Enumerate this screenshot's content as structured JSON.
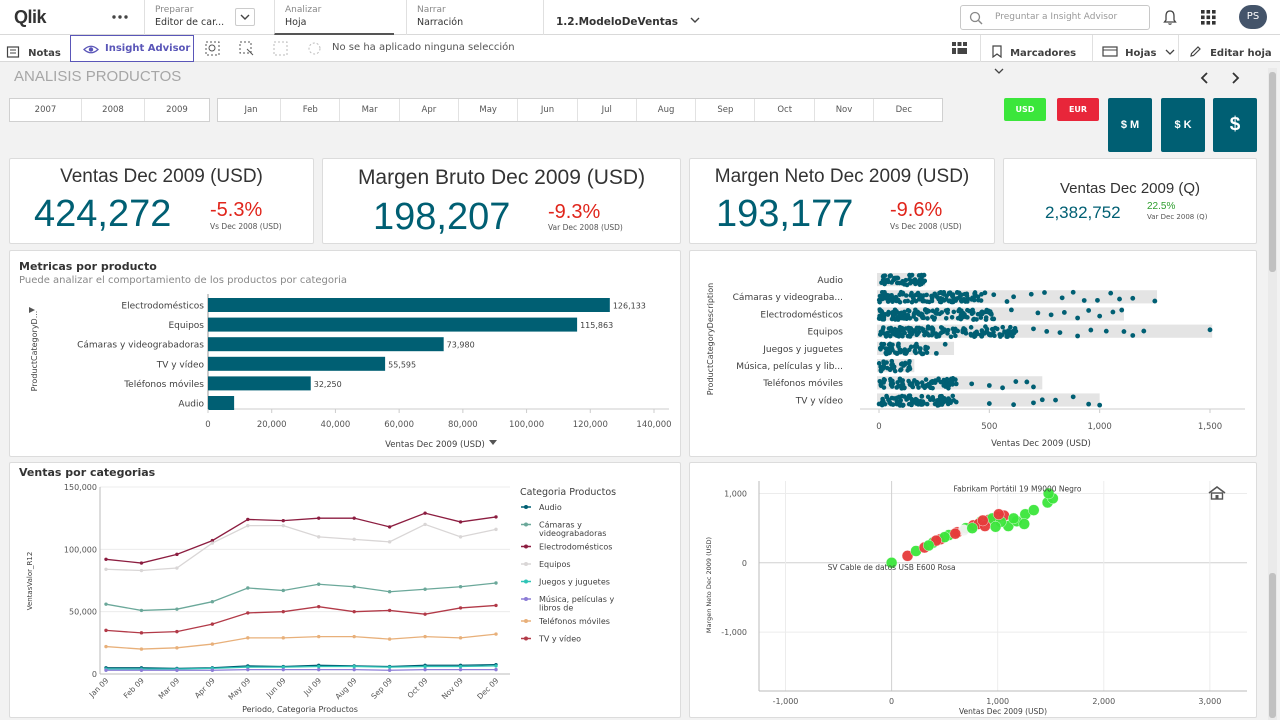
{
  "app": {
    "logo": "Qlik",
    "more_menu": "more-horizontal-icon"
  },
  "nav": {
    "prepare": {
      "label": "Preparar",
      "value": "Editor de car..."
    },
    "analyze": {
      "label": "Analizar",
      "value": "Hoja"
    },
    "narrate": {
      "label": "Narrar",
      "value": "Narración"
    },
    "app_name": "1.2.ModeloDeVentas",
    "search_placeholder": "Preguntar a Insight Advisor",
    "avatar": "PS"
  },
  "toolbar": {
    "notes": "Notas",
    "insight": "Insight Advisor",
    "selection": "No se ha aplicado ninguna selección",
    "bookmarks": "Marcadores",
    "sheets": "Hojas",
    "edit": "Editar hoja"
  },
  "sheet": {
    "title": "ANALISIS PRODUCTOS"
  },
  "years": [
    "2007",
    "2008",
    "2009"
  ],
  "months": [
    "Jan",
    "Feb",
    "Mar",
    "Apr",
    "May",
    "Jun",
    "Jul",
    "Aug",
    "Sep",
    "Oct",
    "Nov",
    "Dec"
  ],
  "currency": {
    "usd": "USD",
    "eur": "EUR",
    "usd_color": "#3be63b",
    "eur_color": "#e8263a"
  },
  "scale": {
    "m": "$ M",
    "k": "$ K",
    "unit": "$"
  },
  "kpis": [
    {
      "title": "Ventas Dec 2009 (USD)",
      "value": "424,272",
      "change": "-5.3%",
      "sub": "Vs Dec 2008 (USD)"
    },
    {
      "title": "Margen Bruto Dec 2009 (USD)",
      "value": "198,207",
      "change": "-9.3%",
      "sub": "Var Dec 2008 (USD)"
    },
    {
      "title": "Margen Neto Dec 2009 (USD)",
      "value": "193,177",
      "change": "-9.6%",
      "sub": "Vs Dec 2008 (USD)"
    },
    {
      "title": "Ventas Dec 2009 (Q)",
      "value": "2,382,752",
      "change": "22.5%",
      "sub": "Var Dec 2008 (Q)"
    }
  ],
  "panels": {
    "metricas": {
      "title": "Metricas por producto",
      "subtitle": "Puede analizar el comportamiento de los productos por categoria"
    },
    "ventas_cat": {
      "title": "Ventas por categorias"
    }
  },
  "chart_data": [
    {
      "type": "bar",
      "orientation": "horizontal",
      "categories": [
        "Electrodomésticos",
        "Equipos",
        "Cámaras y videograbadoras",
        "TV y vídeo",
        "Teléfonos móviles",
        "Audio"
      ],
      "values": [
        126133,
        115863,
        73980,
        55595,
        32250,
        8200
      ],
      "data_labels": [
        "126,133",
        "115,863",
        "73,980",
        "55,595",
        "32,250",
        ""
      ],
      "xlabel": "Ventas Dec 2009 (USD)",
      "ylabel": "ProductCategoryD...",
      "xlim": [
        0,
        140000
      ],
      "xticks": [
        "0",
        "20,000",
        "40,000",
        "60,000",
        "80,000",
        "100,000",
        "120,000",
        "140,000"
      ],
      "color": "#005f73"
    },
    {
      "type": "scatter",
      "subtype": "distribution",
      "categories": [
        "Audio",
        "Cámaras y videograba...",
        "Electrodomésticos",
        "Equipos",
        "Juegos y juguetes",
        "Música, películas y lib...",
        "Teléfonos móviles",
        "TV y vídeo"
      ],
      "ranges": [
        [
          0,
          210
        ],
        [
          0,
          1260
        ],
        [
          0,
          1110
        ],
        [
          0,
          1510
        ],
        [
          0,
          340
        ],
        [
          0,
          160
        ],
        [
          0,
          740
        ],
        [
          0,
          1000
        ]
      ],
      "outliers": [
        [
          200
        ],
        [
          480,
          520,
          580,
          610,
          690,
          750,
          830,
          880,
          930,
          990,
          1050,
          1090,
          1150,
          1250
        ],
        [
          520,
          600,
          720,
          780,
          840,
          900,
          950,
          1000,
          1060,
          1100
        ],
        [
          620,
          700,
          760,
          820,
          900,
          960,
          1030,
          1110,
          1150,
          1200,
          1500
        ],
        [
          220,
          260,
          300
        ],
        [
          140
        ],
        [
          350,
          420,
          500,
          560,
          620,
          670,
          700
        ],
        [
          350,
          500,
          610,
          700,
          740,
          800,
          880,
          950,
          1000
        ]
      ],
      "xlabel": "Ventas Dec 2009 (USD)",
      "ylabel": "ProductCategoryDescription",
      "xlim": [
        -50,
        1560
      ],
      "xticks": [
        "0",
        "500",
        "1,000",
        "1,500"
      ],
      "xtick_values": [
        0,
        500,
        1000,
        1500
      ],
      "color": "#005f73"
    },
    {
      "type": "line",
      "title": "Ventas por categorias",
      "x": [
        "Jan 09",
        "Feb 09",
        "Mar 09",
        "Apr 09",
        "May 09",
        "Jun 09",
        "Jul 09",
        "Aug 09",
        "Sep 09",
        "Oct 09",
        "Nov 09",
        "Dec 09"
      ],
      "xlabel": "Periodo, Categoria Productos",
      "ylabel": "VentasValor_R12",
      "ylim": [
        0,
        150000
      ],
      "yticks": [
        "0",
        "50,000",
        "100,000",
        "150,000"
      ],
      "legend_title": "Categoria Productos",
      "series": [
        {
          "name": "Audio",
          "color": "#005f73",
          "values": [
            5000,
            5000,
            4500,
            5000,
            6500,
            6000,
            7000,
            6500,
            6000,
            7000,
            7000,
            7500
          ]
        },
        {
          "name": "Cámaras y videograbadoras",
          "color": "#6ba89a",
          "values": [
            56000,
            51000,
            52000,
            58000,
            69000,
            67000,
            72000,
            70000,
            66000,
            68000,
            70000,
            73000
          ]
        },
        {
          "name": "Electrodomésticos",
          "color": "#8c1d40",
          "values": [
            92000,
            89000,
            96000,
            107000,
            124000,
            123000,
            125000,
            125000,
            118000,
            129000,
            122000,
            126000
          ]
        },
        {
          "name": "Equipos",
          "color": "#d9d6d6",
          "values": [
            84000,
            83000,
            85000,
            105000,
            119000,
            119000,
            110000,
            108000,
            106000,
            120000,
            110000,
            116000
          ]
        },
        {
          "name": "Juegos y juguetes",
          "color": "#2ec4b6",
          "values": [
            4000,
            4000,
            4000,
            4500,
            5500,
            5500,
            6000,
            6000,
            5500,
            6000,
            6000,
            6500
          ]
        },
        {
          "name": "Música, películas y libros de",
          "color": "#8c7cd6",
          "values": [
            3000,
            3000,
            3000,
            3000,
            3500,
            3500,
            3500,
            3500,
            3000,
            3500,
            3500,
            3500
          ]
        },
        {
          "name": "Teléfonos móviles",
          "color": "#e8b07a",
          "values": [
            22000,
            20000,
            21000,
            24000,
            29000,
            29000,
            30000,
            30000,
            28000,
            30000,
            29000,
            32000
          ]
        },
        {
          "name": "TV y vídeo",
          "color": "#b23a48",
          "values": [
            35000,
            33000,
            34000,
            40000,
            49000,
            50000,
            54000,
            50000,
            51000,
            48000,
            53000,
            55000
          ]
        }
      ]
    },
    {
      "type": "scatter",
      "xlabel": "Ventas Dec 2009 (USD)",
      "ylabel": "Margen Neto Dec 2009 (USD)",
      "xlim": [
        -1250,
        3350
      ],
      "ylim": [
        -1850,
        1180
      ],
      "xticks": [
        "-1,000",
        "0",
        "1,000",
        "2,000",
        "3,000"
      ],
      "xtick_values": [
        -1000,
        0,
        1000,
        2000,
        3000
      ],
      "yticks": [
        "1,000",
        "0",
        "-1,000"
      ],
      "ytick_values": [
        1000,
        0,
        -1000
      ],
      "annotations": [
        {
          "text": "Fabrikam Portátil 19 M9000 Negro",
          "x": 1450,
          "y": 1030
        },
        {
          "text": "SV Cable de datos USB E600 Rosa",
          "x": 0,
          "y": -150
        }
      ],
      "points": [
        {
          "x": 0,
          "y": 0,
          "c": "#3be63b"
        },
        {
          "x": 150,
          "y": 100,
          "c": "#e63b3b"
        },
        {
          "x": 230,
          "y": 170,
          "c": "#3be63b"
        },
        {
          "x": 310,
          "y": 220,
          "c": "#e63b3b"
        },
        {
          "x": 390,
          "y": 290,
          "c": "#3be63b"
        },
        {
          "x": 460,
          "y": 340,
          "c": "#e63b3b"
        },
        {
          "x": 540,
          "y": 400,
          "c": "#3be63b"
        },
        {
          "x": 620,
          "y": 440,
          "c": "#e63b3b"
        },
        {
          "x": 700,
          "y": 500,
          "c": "#3be63b"
        },
        {
          "x": 770,
          "y": 540,
          "c": "#e63b3b"
        },
        {
          "x": 840,
          "y": 590,
          "c": "#3be63b"
        },
        {
          "x": 920,
          "y": 620,
          "c": "#e63b3b"
        },
        {
          "x": 1000,
          "y": 660,
          "c": "#e63b3b"
        },
        {
          "x": 1060,
          "y": 680,
          "c": "#e63b3b"
        },
        {
          "x": 1100,
          "y": 530,
          "c": "#3be63b"
        },
        {
          "x": 1180,
          "y": 600,
          "c": "#3be63b"
        },
        {
          "x": 1260,
          "y": 700,
          "c": "#3be63b"
        },
        {
          "x": 1340,
          "y": 760,
          "c": "#3be63b"
        },
        {
          "x": 1250,
          "y": 560,
          "c": "#3be63b"
        },
        {
          "x": 1470,
          "y": 870,
          "c": "#3be63b"
        },
        {
          "x": 1520,
          "y": 930,
          "c": "#3be63b"
        },
        {
          "x": 1480,
          "y": 1000,
          "c": "#3be63b"
        },
        {
          "x": 680,
          "y": 470,
          "c": "#f2f2f2"
        },
        {
          "x": 820,
          "y": 560,
          "c": "#e63b3b"
        },
        {
          "x": 950,
          "y": 640,
          "c": "#3be63b"
        },
        {
          "x": 880,
          "y": 530,
          "c": "#e63b3b"
        },
        {
          "x": 760,
          "y": 500,
          "c": "#3be63b"
        },
        {
          "x": 600,
          "y": 420,
          "c": "#e63b3b"
        },
        {
          "x": 1030,
          "y": 590,
          "c": "#3be63b"
        },
        {
          "x": 1010,
          "y": 700,
          "c": "#e63b3b"
        },
        {
          "x": 980,
          "y": 520,
          "c": "#3be63b"
        },
        {
          "x": 860,
          "y": 610,
          "c": "#e63b3b"
        },
        {
          "x": 500,
          "y": 370,
          "c": "#3be63b"
        },
        {
          "x": 420,
          "y": 320,
          "c": "#e63b3b"
        },
        {
          "x": 350,
          "y": 250,
          "c": "#3be63b"
        },
        {
          "x": 1150,
          "y": 640,
          "c": "#3be63b"
        }
      ],
      "color_up": "#3be63b",
      "color_down": "#e63b3b"
    }
  ]
}
